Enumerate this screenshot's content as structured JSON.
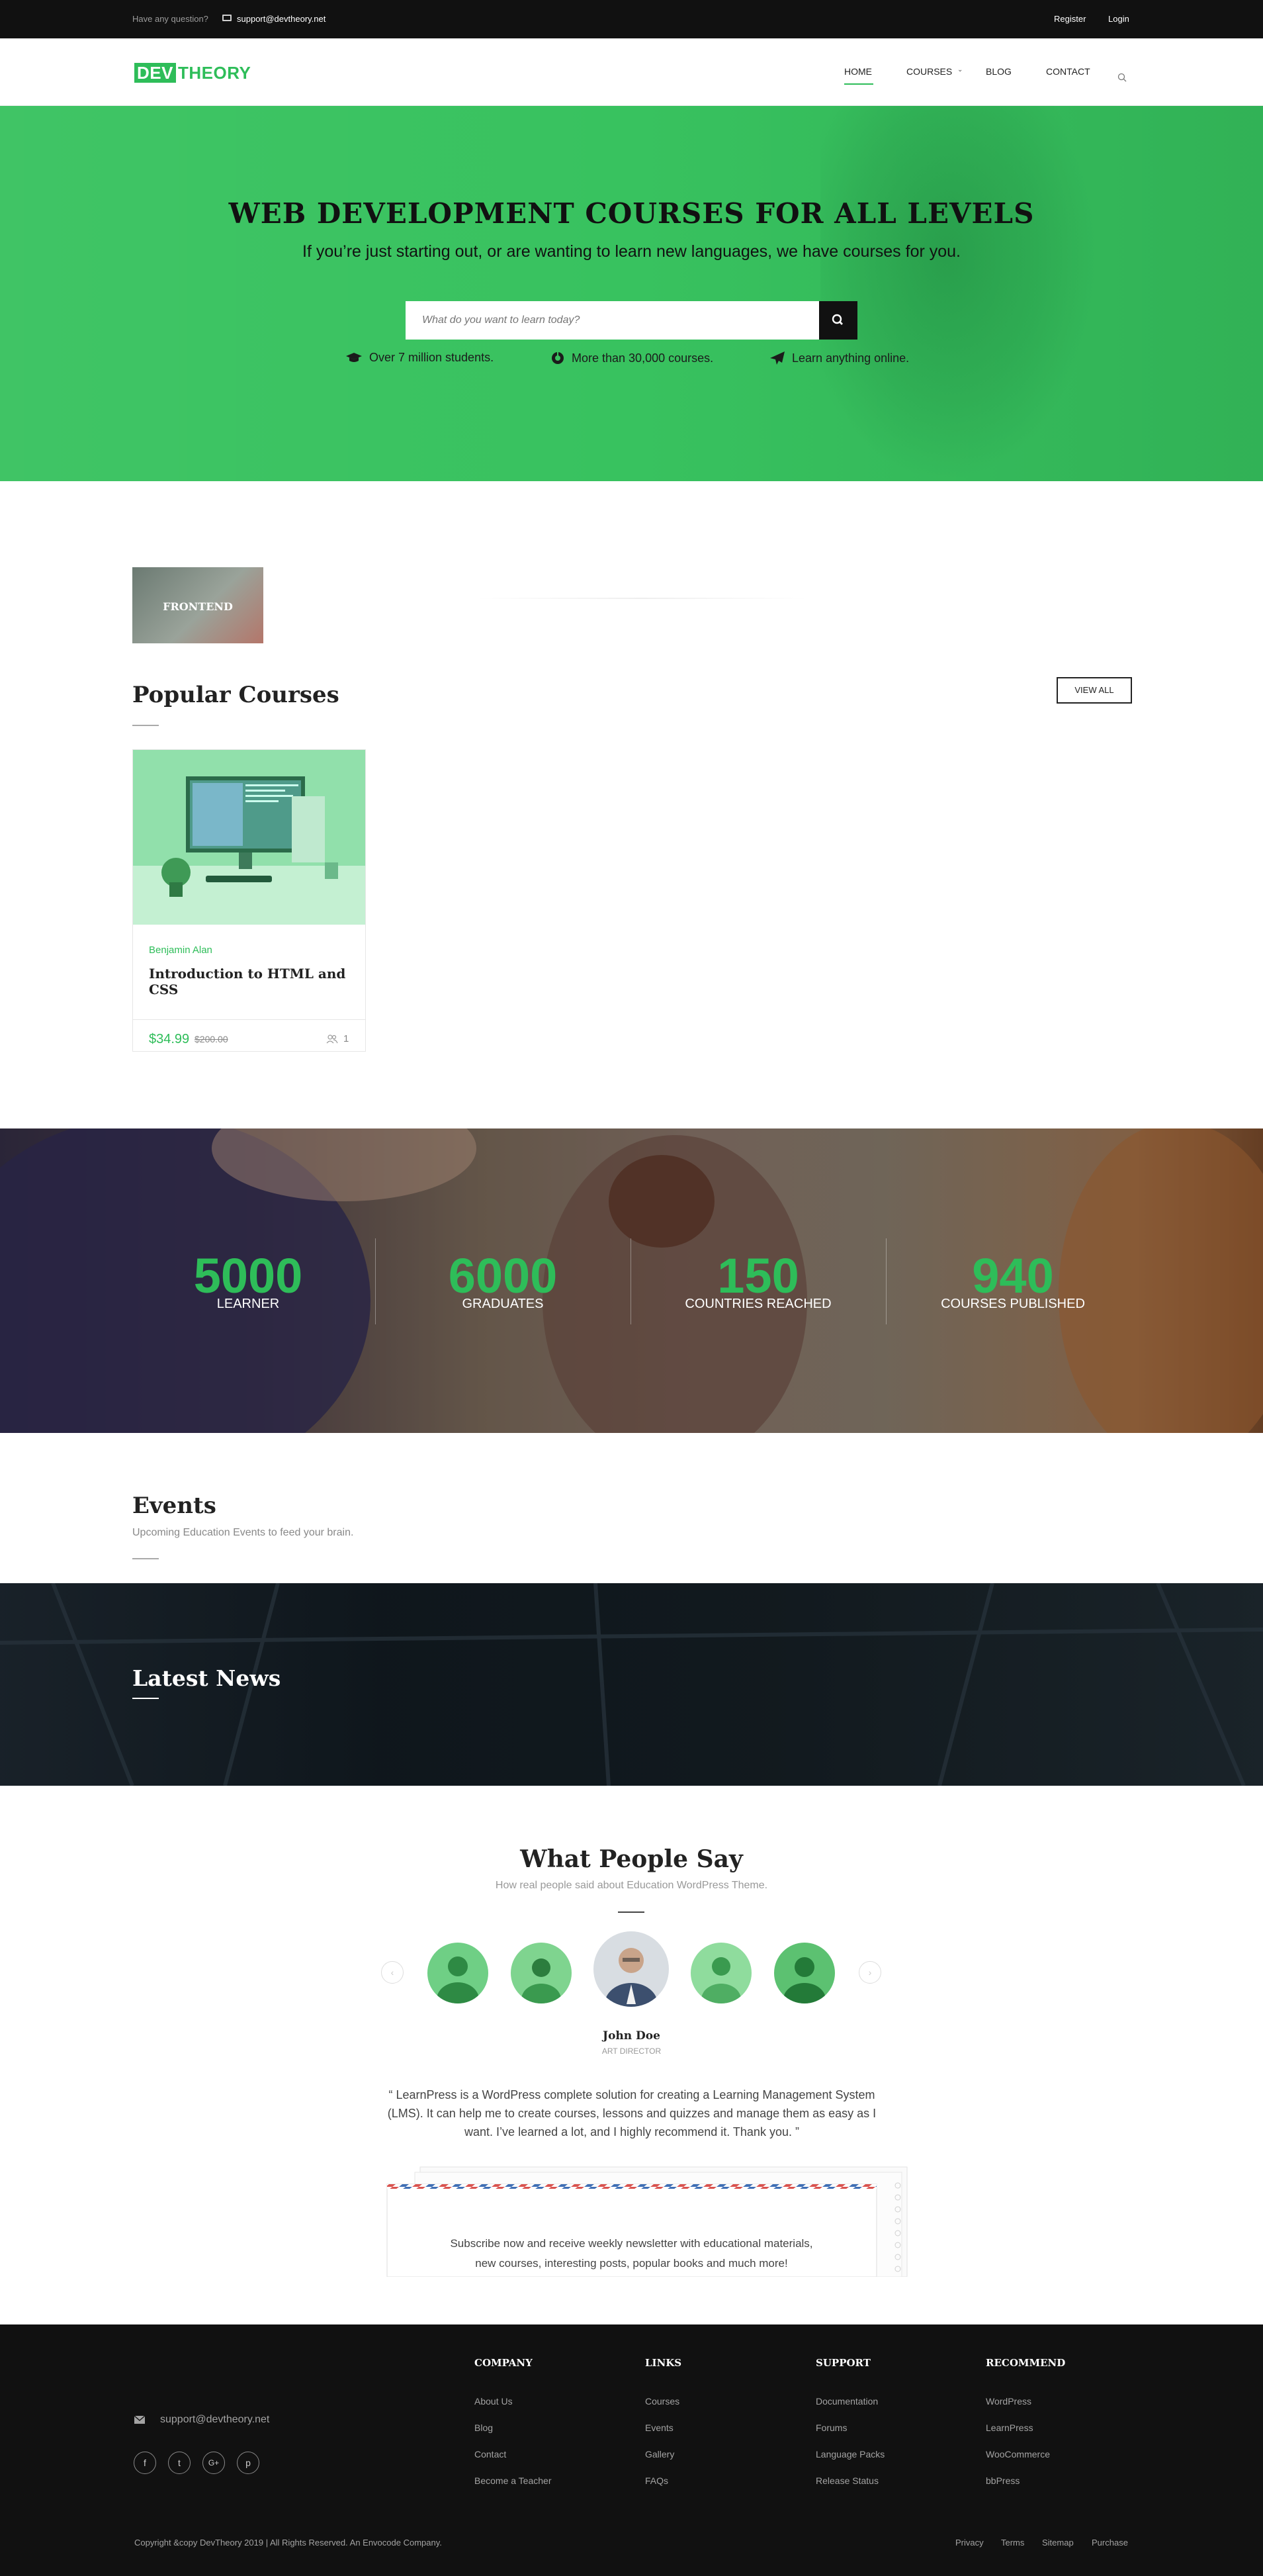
{
  "topbar": {
    "question": "Have any question?",
    "email": "support@devtheory.net",
    "register": "Register",
    "login": "Login"
  },
  "header": {
    "logo_part1": "DEV",
    "logo_part2": "THEORY",
    "nav": [
      "HOME",
      "COURSES",
      "BLOG",
      "CONTACT"
    ],
    "active_nav": "HOME",
    "brand_color": "#2ebd59"
  },
  "hero": {
    "title": "WEB DEVELOPMENT COURSES FOR ALL LEVELS",
    "subtitle": "If you’re just starting out, or are wanting to learn new languages, we have courses for you.",
    "search_placeholder": "What do you want to learn today?",
    "features": [
      {
        "icon": "graduation-cap-icon",
        "text": "Over 7 million students."
      },
      {
        "icon": "rebel-icon",
        "text": "More than 30,000 courses."
      },
      {
        "icon": "paper-plane-icon",
        "text": "Learn anything online."
      }
    ]
  },
  "category": {
    "label": "FRONTEND"
  },
  "popular": {
    "title": "Popular Courses",
    "view_all": "VIEW ALL",
    "course": {
      "author": "Benjamin Alan",
      "title": "Introduction to HTML and CSS",
      "price": "$34.99",
      "old_price": "$200.00",
      "students": "1"
    }
  },
  "stats": [
    {
      "number": "5000",
      "label": "LEARNER"
    },
    {
      "number": "6000",
      "label": "GRADUATES"
    },
    {
      "number": "150",
      "label": "COUNTRIES REACHED"
    },
    {
      "number": "940",
      "label": "COURSES PUBLISHED"
    }
  ],
  "events": {
    "title": "Events",
    "subtitle": "Upcoming Education Events to feed your brain."
  },
  "news": {
    "title": "Latest News"
  },
  "testimonials": {
    "title": "What People Say",
    "subtitle": "How real people said about Education WordPress Theme.",
    "name": "John Doe",
    "role": "ART DIRECTOR",
    "quote": "“ LearnPress is a WordPress complete solution for creating a Learning Management System (LMS). It can help me to create courses, lessons and quizzes and manage them as easy as I want. I’ve learned a lot, and I highly recommend it. Thank you. ”"
  },
  "newsletter": {
    "line1": "Subscribe now and receive weekly newsletter with educational materials,",
    "line2": "new courses, interesting posts, popular books and much more!"
  },
  "footer": {
    "email": "support@devtheory.net",
    "socials": [
      "f",
      "t",
      "G+",
      "p"
    ],
    "columns": [
      {
        "title": "COMPANY",
        "links": [
          "About Us",
          "Blog",
          "Contact",
          "Become a Teacher"
        ]
      },
      {
        "title": "LINKS",
        "links": [
          "Courses",
          "Events",
          "Gallery",
          "FAQs"
        ]
      },
      {
        "title": "SUPPORT",
        "links": [
          "Documentation",
          "Forums",
          "Language Packs",
          "Release Status"
        ]
      },
      {
        "title": "RECOMMEND",
        "links": [
          "WordPress",
          "LearnPress",
          "WooCommerce",
          "bbPress"
        ]
      }
    ],
    "copyright": "Copyright &copy DevTheory 2019 | All Rights Reserved. An Envocode Company.",
    "bottom_links": [
      "Privacy",
      "Terms",
      "Sitemap",
      "Purchase"
    ]
  }
}
